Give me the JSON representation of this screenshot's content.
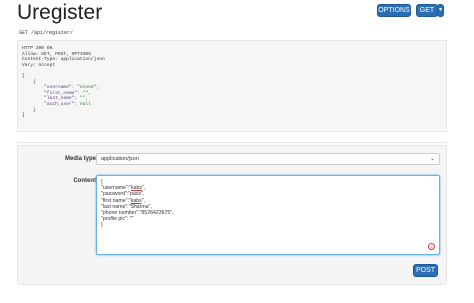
{
  "page": {
    "title": "Uregister"
  },
  "toolbar": {
    "options_label": "OPTIONS",
    "get_label": "GET",
    "caret": "▾"
  },
  "request": {
    "line": "GET /api/register/"
  },
  "response": {
    "status": "HTTP 200 OK",
    "allow_key": "Allow:",
    "allow_val": " GET, POST, OPTIONS",
    "ctype_key": "Content-Type:",
    "ctype_val": " application/json",
    "vary_key": "Vary:",
    "vary_val": " Accept",
    "body_open_bracket": "[",
    "body_open_brace": "    {",
    "username_key": "        \"username\"",
    "username_val": ": \"ezone\",",
    "first_name_key": "        \"first_name\"",
    "first_name_val": ": \"\",",
    "last_name_key": "        \"last_name\"",
    "last_name_val": ": \"\",",
    "auth_user_key": "        \"auth_user\"",
    "auth_user_val": ": null",
    "body_close_brace": "    }",
    "body_close_bracket": "]"
  },
  "form": {
    "media_type_label": "Media type:",
    "media_type_value": "application/json",
    "content_label": "Content:",
    "content": {
      "l1": "{",
      "l2a": "\"username\":\"",
      "l2b": "kabs",
      "l2c": "\",",
      "l3": "\"password\":\"pass\",",
      "l4a": "\"first name\":\"",
      "l4b": "kabs",
      "l4c": "\",",
      "l5": "\"last name\":\"Sharma\",",
      "l6": "\"phone number\":\"8526423675\",",
      "l7": "\"profile pic\": \"\"",
      "l8": "}"
    },
    "resize_badge": "2",
    "post_label": "POST"
  }
}
